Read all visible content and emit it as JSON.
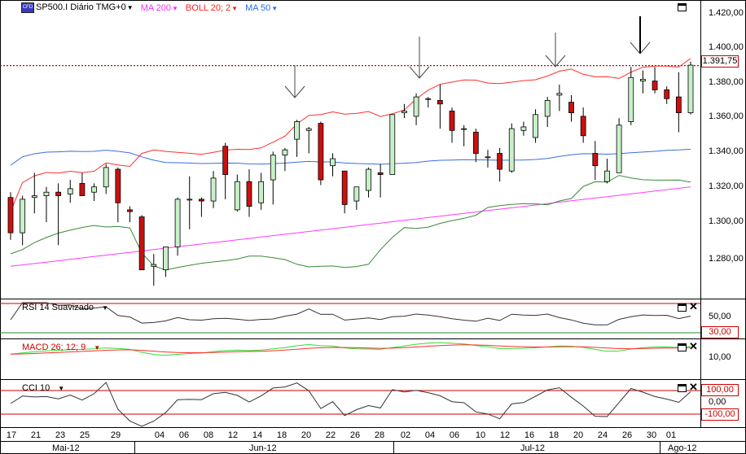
{
  "header": {
    "symbol": "SP500.I Diário TMG+0",
    "ma200": "MA 200",
    "boll": "BOLL 20; 2",
    "ma50": "MA 50",
    "symbol_icon_text": "CFD"
  },
  "price_axis": {
    "ticks": [
      "1.420,00",
      "1.400,00",
      "1.380,00",
      "1.360,00",
      "1.340,00",
      "1.320,00",
      "1.300,00",
      "1.280,00"
    ],
    "current_tag": "1.391,75"
  },
  "rsi": {
    "title": "RSI 14 Suavizado",
    "ticks": [
      "50,00"
    ],
    "tag": "30,00"
  },
  "macd": {
    "title": "MACD 26; 12; 9",
    "ticks": [
      "10,00"
    ]
  },
  "cci": {
    "title": "CCI 10",
    "ticks": [
      "0,00"
    ],
    "tag_upper": "100,00",
    "tag_lower": "-100,00"
  },
  "x_axis": {
    "days": [
      "17",
      "21",
      "23",
      "25",
      "29",
      "04",
      "06",
      "08",
      "12",
      "14",
      "18",
      "20",
      "22",
      "26",
      "28",
      "02",
      "04",
      "06",
      "10",
      "12",
      "16",
      "18",
      "20",
      "24",
      "26",
      "30",
      "01"
    ],
    "months": [
      "Mai-12",
      "Jun-12",
      "Jul-12",
      "Ago-12"
    ]
  },
  "colors": {
    "up_fill": "#c8f0c8",
    "down_fill": "#cc1010",
    "boll": "#ff3030",
    "boll_lower": "#3a8a3a",
    "ma50": "#3a6ee0",
    "ma200": "#ff3cff",
    "price_line": "#cc0000"
  },
  "chart_data": {
    "type": "candlestick",
    "ylim": [
      1262,
      1428
    ],
    "last_price": 1391.75,
    "candles": [
      [
        1317,
        1320,
        1293,
        1297
      ],
      [
        1297,
        1318,
        1290,
        1316
      ],
      [
        1317,
        1331,
        1308,
        1318
      ],
      [
        1318,
        1323,
        1303,
        1320
      ],
      [
        1320,
        1325,
        1290,
        1318
      ],
      [
        1319,
        1327,
        1314,
        1322
      ],
      [
        1325,
        1331,
        1320,
        1318
      ],
      [
        1320,
        1325,
        1315,
        1323
      ],
      [
        1323,
        1336,
        1319,
        1334
      ],
      [
        1333,
        1334,
        1303,
        1314
      ],
      [
        1310,
        1312,
        1303,
        1309
      ],
      [
        1306,
        1307,
        1277,
        1276
      ],
      [
        1278,
        1285,
        1267,
        1279
      ],
      [
        1276,
        1288,
        1272,
        1289
      ],
      [
        1289,
        1317,
        1284,
        1316
      ],
      [
        1316,
        1329,
        1299,
        1316
      ],
      [
        1316,
        1317,
        1306,
        1315
      ],
      [
        1315,
        1332,
        1311,
        1328
      ],
      [
        1346,
        1348,
        1316,
        1330
      ],
      [
        1310,
        1330,
        1309,
        1326
      ],
      [
        1326,
        1333,
        1306,
        1312
      ],
      [
        1314,
        1331,
        1310,
        1326
      ],
      [
        1327,
        1343,
        1313,
        1341
      ],
      [
        1341,
        1345,
        1332,
        1344
      ],
      [
        1350,
        1361,
        1340,
        1360
      ],
      [
        1355,
        1357,
        1342,
        1356
      ],
      [
        1359,
        1360,
        1324,
        1327
      ],
      [
        1335,
        1342,
        1329,
        1339
      ],
      [
        1332,
        1332,
        1308,
        1313
      ],
      [
        1315,
        1322,
        1310,
        1323
      ],
      [
        1321,
        1334,
        1317,
        1333
      ],
      [
        1331,
        1336,
        1317,
        1330
      ],
      [
        1330,
        1362,
        1330,
        1364
      ],
      [
        1365,
        1370,
        1362,
        1366
      ],
      [
        1363,
        1376,
        1358,
        1374
      ],
      [
        1373,
        1374,
        1368,
        1373
      ],
      [
        1372,
        1381,
        1356,
        1370
      ],
      [
        1366,
        1368,
        1348,
        1355
      ],
      [
        1356,
        1358,
        1346,
        1356
      ],
      [
        1354,
        1356,
        1337,
        1342
      ],
      [
        1340,
        1344,
        1334,
        1340
      ],
      [
        1342,
        1345,
        1326,
        1333
      ],
      [
        1332,
        1359,
        1331,
        1356
      ],
      [
        1355,
        1360,
        1352,
        1357
      ],
      [
        1351,
        1367,
        1348,
        1364
      ],
      [
        1363,
        1374,
        1357,
        1372
      ],
      [
        1375,
        1381,
        1366,
        1376
      ],
      [
        1371,
        1375,
        1360,
        1365
      ],
      [
        1363,
        1368,
        1348,
        1352
      ],
      [
        1342,
        1349,
        1327,
        1335
      ],
      [
        1326,
        1339,
        1325,
        1332
      ],
      [
        1331,
        1362,
        1331,
        1358
      ],
      [
        1360,
        1391,
        1358,
        1385
      ],
      [
        1383,
        1389,
        1376,
        1384
      ],
      [
        1383,
        1391,
        1376,
        1378
      ],
      [
        1378,
        1380,
        1370,
        1373
      ],
      [
        1374,
        1388,
        1354,
        1365
      ],
      [
        1365,
        1394,
        1364,
        1392
      ]
    ]
  }
}
